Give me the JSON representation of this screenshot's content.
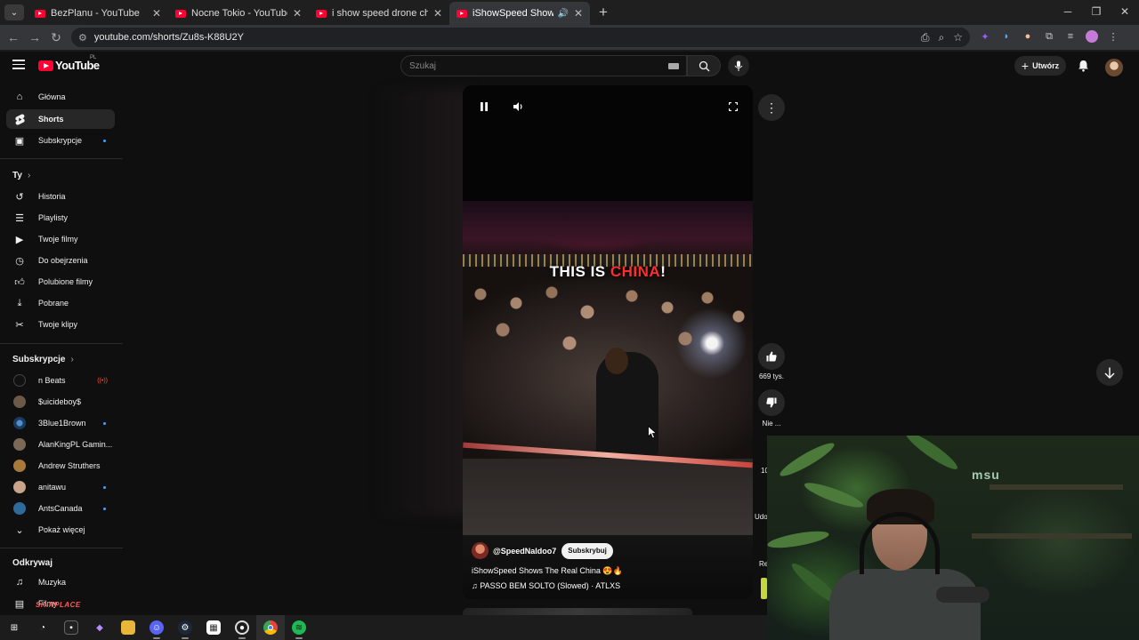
{
  "browser": {
    "tabs": [
      {
        "title": "BezPlanu - YouTube",
        "active": false
      },
      {
        "title": "Nocne Tokio - YouTube",
        "active": false
      },
      {
        "title": "i show speed drone china - You",
        "active": false
      },
      {
        "title": "iShowSpeed Shows The Re",
        "active": true
      }
    ],
    "url": "youtube.com/shorts/Zu8s-K88U2Y"
  },
  "masthead": {
    "logo_text": "YouTube",
    "region": "PL",
    "search_placeholder": "Szukaj",
    "create_label": "Utwórz"
  },
  "sidebar": {
    "main": [
      {
        "label": "Główna",
        "icon": "home-icon"
      },
      {
        "label": "Shorts",
        "icon": "shorts-icon",
        "active": true
      },
      {
        "label": "Subskrypcje",
        "icon": "subscriptions-icon",
        "dot": true
      }
    ],
    "you_header": "Ty",
    "you": [
      {
        "label": "Historia",
        "icon": "history-icon"
      },
      {
        "label": "Playlisty",
        "icon": "playlists-icon"
      },
      {
        "label": "Twoje filmy",
        "icon": "your-videos-icon"
      },
      {
        "label": "Do obejrzenia",
        "icon": "watch-later-icon"
      },
      {
        "label": "Polubione filmy",
        "icon": "liked-videos-icon"
      },
      {
        "label": "Pobrane",
        "icon": "downloads-icon"
      },
      {
        "label": "Twoje klipy",
        "icon": "clips-icon"
      }
    ],
    "subs_header": "Subskrypcje",
    "subs": [
      {
        "label": "n Beats",
        "color": "#111111",
        "live": true
      },
      {
        "label": "$uicideboy$",
        "color": "#6b5a48"
      },
      {
        "label": "3Blue1Brown",
        "color": "#1b3a5c",
        "dot": true
      },
      {
        "label": "AlanKingPL Gamin...",
        "color": "#7a6a55"
      },
      {
        "label": "Andrew Struthers",
        "color": "#a77a3a"
      },
      {
        "label": "anitawu",
        "color": "#c9a38a",
        "dot": true
      },
      {
        "label": "AntsCanada",
        "color": "#2e6a9a",
        "dot": true
      }
    ],
    "show_more": "Pokaż więcej",
    "explore_header": "Odkrywaj",
    "explore": [
      {
        "label": "Muzyka",
        "icon": "music-icon"
      },
      {
        "label": "Filmy",
        "icon": "movies-icon"
      }
    ]
  },
  "short": {
    "overlay_text_1": "THIS IS ",
    "overlay_text_2": "CHINA",
    "overlay_text_3": "!",
    "channel": "@SpeedNaldoo7",
    "subscribe_label": "Subskrybuj",
    "title": "iShowSpeed Shows The Real China 😍🔥",
    "music": "♫ PASSO BEM SOLTO (Slowed) · ATLXS"
  },
  "actions": {
    "like_count": "669 tys.",
    "dislike_label": "Nie ...",
    "comments_partial": "10",
    "share_partial": "Udo",
    "remix_partial": "Re"
  },
  "overlays": {
    "webcam_sign": "msu",
    "watermark": "SKINPLACE"
  },
  "colors": {
    "yt_red": "#ff0033",
    "background": "#0f0f0f",
    "accent_blue": "#3ea6ff"
  }
}
